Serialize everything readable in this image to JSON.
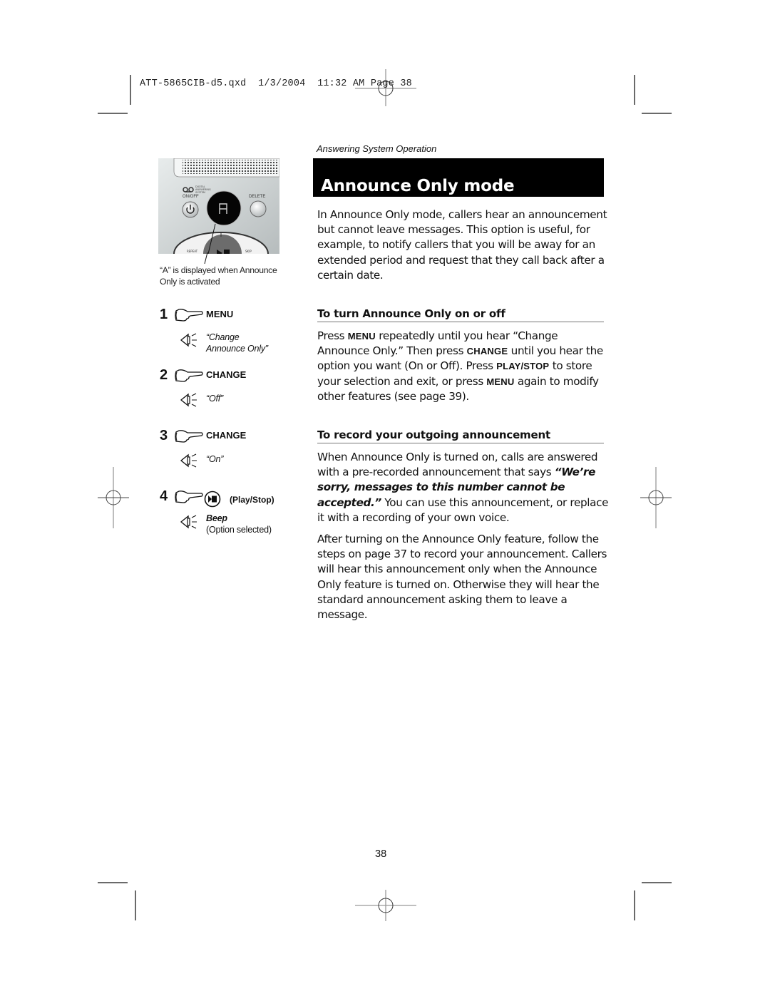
{
  "slug": {
    "file": "ATT-5865CIB-d5.qxd",
    "date": "1/3/2004",
    "time": "11:32 AM",
    "page_label": "Page 38"
  },
  "section_label": "Answering System Operation",
  "title": "Announce Only mode",
  "device_image": {
    "logo_text": "DIGITAL ANSWERING SYSTEM",
    "on_off_label": "ON/OFF",
    "delete_label": "DELETE",
    "display_char": "A",
    "left_button_label": "REPEAT",
    "right_button_label": "SKIP",
    "caption": "“A” is displayed when Announce Only is activated"
  },
  "intro": "In Announce Only mode, callers hear an announcement but cannot leave messages. This option is useful, for example, to notify callers that you will be away for an extended period and request that they call back after a certain date.",
  "section1": {
    "heading": "To turn Announce Only on or off",
    "parts": [
      {
        "t": "Press ",
        "k": false
      },
      {
        "t": "MENU",
        "k": true
      },
      {
        "t": " repeatedly until you hear “Change Announce Only.” Then press ",
        "k": false
      },
      {
        "t": "CHANGE",
        "k": true
      },
      {
        "t": " until you hear the option you want (On or Off). Press ",
        "k": false
      },
      {
        "t": "PLAY/STOP",
        "k": true
      },
      {
        "t": " to store your selection and exit, or press ",
        "k": false
      },
      {
        "t": "MENU",
        "k": true
      },
      {
        "t": " again to modify other features (see page 39).",
        "k": false
      }
    ]
  },
  "section2": {
    "heading": "To record your outgoing announcement",
    "p1_before": "When Announce Only is turned on, calls are answered with a pre-recorded announcement  that says ",
    "p1_quote": "“We’re sorry, messages to this number cannot be accepted.”",
    "p1_after": " You can use this announcement, or replace it with a recording of your own voice.",
    "p2": "After turning on the Announce Only feature, follow the steps on page 37 to record your announcement. Callers will hear this announcement only when the Announce Only feature is turned on. Otherwise they will hear the standard announcement asking them to leave a message."
  },
  "steps": [
    {
      "num": "1",
      "action_icon": "pointing-hand-icon",
      "key": "MENU",
      "say": "“Change",
      "say2": "Announce Only”"
    },
    {
      "num": "2",
      "action_icon": "pointing-hand-icon",
      "key": "CHANGE",
      "say": "“Off”"
    },
    {
      "num": "3",
      "action_icon": "pointing-hand-icon",
      "key": "CHANGE",
      "say": "“On”"
    },
    {
      "num": "4",
      "action_icon": "pointing-hand-icon",
      "button_icon": "play-stop-icon",
      "key": "(Play/Stop)",
      "say": "Beep",
      "note": "(Option selected)"
    }
  ],
  "page_number": "38"
}
